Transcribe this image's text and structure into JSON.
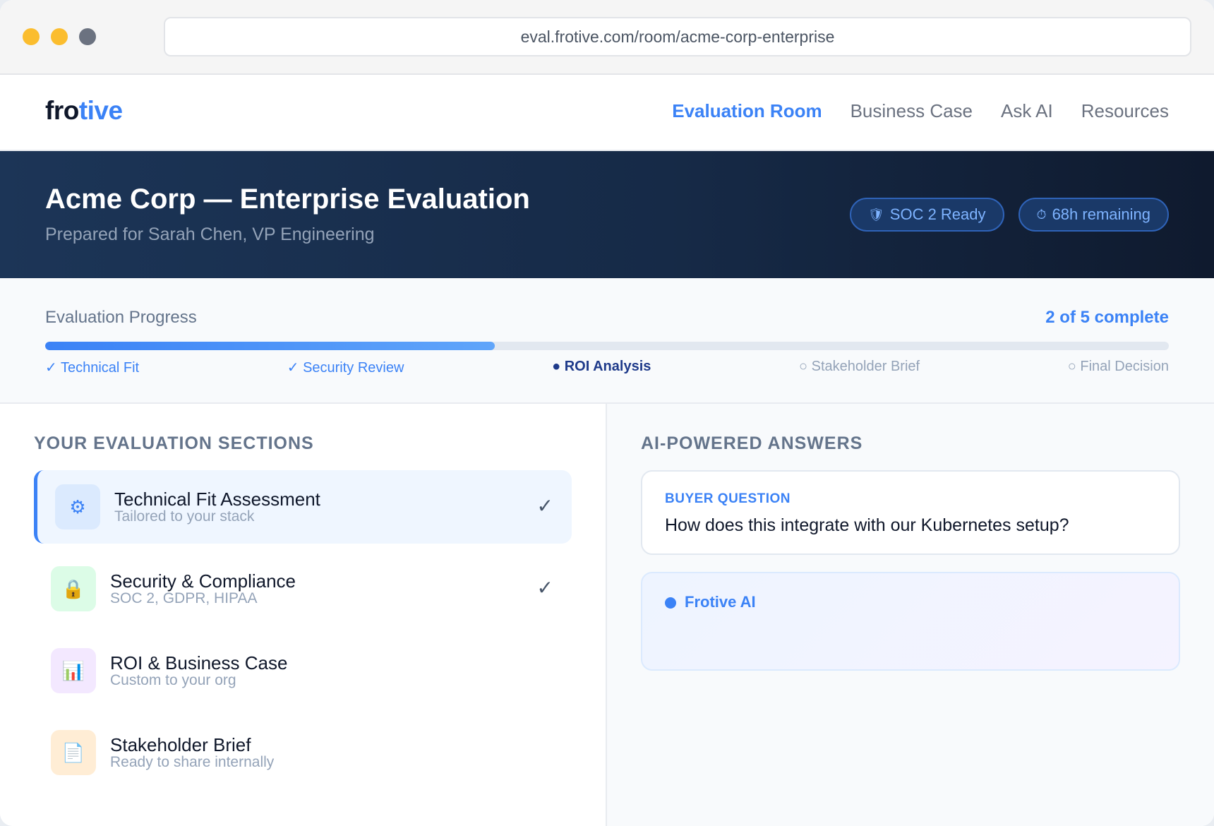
{
  "browser": {
    "url": "eval.frotive.com/room/acme-corp-enterprise"
  },
  "brand": {
    "logo_part1": "fro",
    "logo_part2": "tive",
    "accent_color": "#3b82f6"
  },
  "nav": {
    "items": [
      {
        "label": "Evaluation Room",
        "active": true
      },
      {
        "label": "Business Case",
        "active": false
      },
      {
        "label": "Ask AI",
        "active": false
      },
      {
        "label": "Resources",
        "active": false
      }
    ]
  },
  "hero": {
    "title": "Acme Corp — Enterprise Evaluation",
    "subtitle": "Prepared for Sarah Chen, VP Engineering",
    "badges": [
      {
        "icon": "shield-icon",
        "glyph": "🛡",
        "label": "SOC 2 Ready"
      },
      {
        "icon": "clock-icon",
        "glyph": "⏱",
        "label": "68h remaining"
      }
    ]
  },
  "progress": {
    "label": "Evaluation Progress",
    "count_text": "2 of 5 complete",
    "percent": 40,
    "steps": [
      {
        "label": "✓ Technical Fit",
        "state": "done"
      },
      {
        "label": "✓ Security Review",
        "state": "done"
      },
      {
        "label": "● ROI Analysis",
        "state": "current"
      },
      {
        "label": "○ Stakeholder Brief",
        "state": "todo"
      },
      {
        "label": "○ Final Decision",
        "state": "todo"
      }
    ]
  },
  "sections": {
    "heading": "YOUR EVALUATION SECTIONS",
    "items": [
      {
        "title": "Technical Fit Assessment",
        "desc": "Tailored to your stack",
        "icon": "gear-icon",
        "glyph": "⚙",
        "color": "blue",
        "checked": true,
        "active": true
      },
      {
        "title": "Security & Compliance",
        "desc": "SOC 2, GDPR, HIPAA",
        "icon": "lock-icon",
        "glyph": "🔒",
        "color": "green",
        "checked": true,
        "active": false
      },
      {
        "title": "ROI & Business Case",
        "desc": "Custom to your org",
        "icon": "chart-icon",
        "glyph": "📊",
        "color": "purple",
        "checked": false,
        "active": false
      },
      {
        "title": "Stakeholder Brief",
        "desc": "Ready to share internally",
        "icon": "document-icon",
        "glyph": "📄",
        "color": "orange",
        "checked": false,
        "active": false
      }
    ],
    "check_glyph": "✓"
  },
  "ai": {
    "heading": "AI-POWERED ANSWERS",
    "question_label": "BUYER QUESTION",
    "question_text": "How does this integrate with our Kubernetes setup?",
    "assistant_name": "Frotive AI"
  }
}
